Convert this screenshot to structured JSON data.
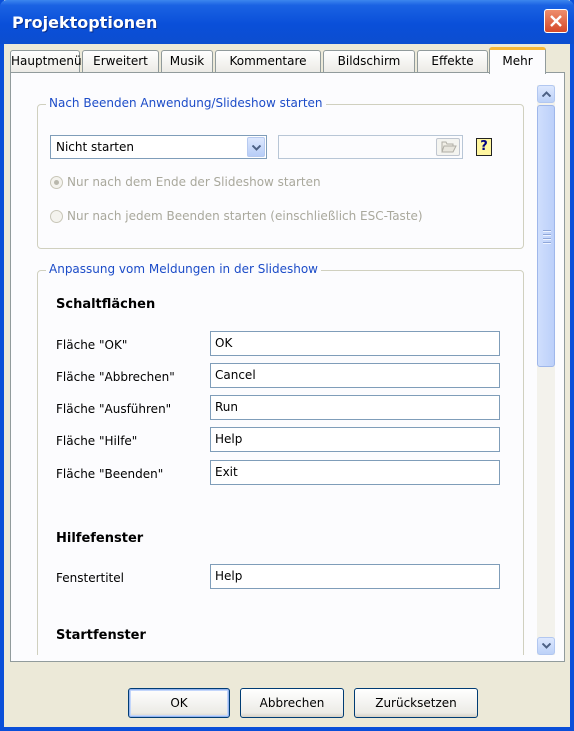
{
  "window": {
    "title": "Projektoptionen"
  },
  "tabs": [
    "Hauptmenü",
    "Erweitert",
    "Musik",
    "Kommentare",
    "Bildschirm",
    "Effekte",
    "Mehr"
  ],
  "active_tab": "Mehr",
  "start_group": {
    "legend": "Nach Beenden Anwendung/Slideshow starten",
    "combo_value": "Nicht starten",
    "path_value": "",
    "help_label": "?",
    "radio_end": "Nur nach dem Ende der Slideshow starten",
    "radio_any": "Nur nach jedem Beenden starten (einschließlich ESC-Taste)"
  },
  "messages_group": {
    "legend": "Anpassung vom Meldungen in der Slideshow",
    "buttons_heading": "Schaltflächen",
    "fields": [
      {
        "label": "Fläche \"OK\"",
        "value": "OK"
      },
      {
        "label": "Fläche \"Abbrechen\"",
        "value": "Cancel"
      },
      {
        "label": "Fläche \"Ausführen\"",
        "value": "Run"
      },
      {
        "label": "Fläche \"Hilfe\"",
        "value": "Help"
      },
      {
        "label": "Fläche \"Beenden\"",
        "value": "Exit"
      }
    ],
    "help_heading": "Hilfefenster",
    "help_title_label": "Fenstertitel",
    "help_title_value": "Help",
    "start_heading": "Startfenster"
  },
  "footer": {
    "ok": "OK",
    "cancel": "Abbrechen",
    "reset": "Zurücksetzen"
  }
}
